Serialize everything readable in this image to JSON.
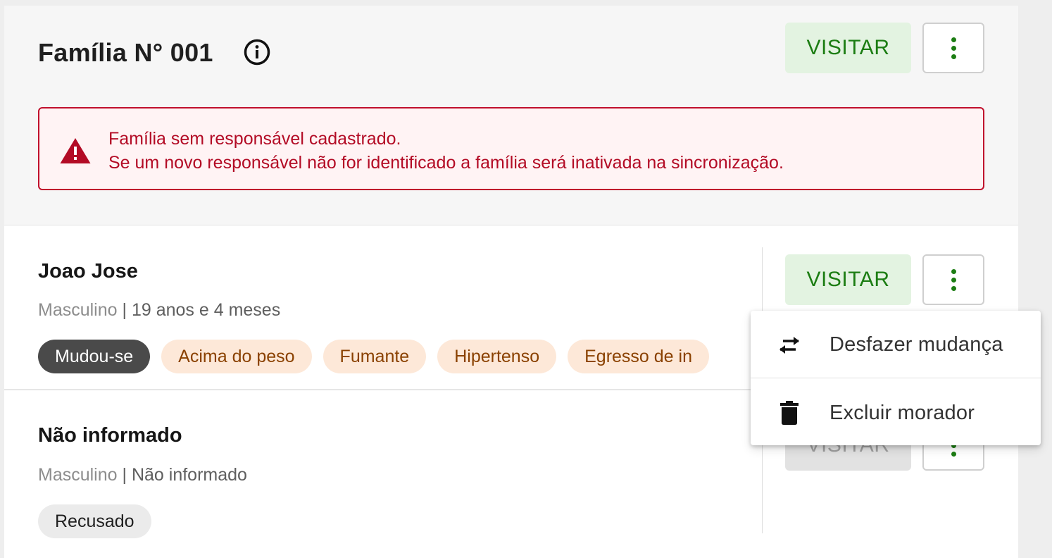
{
  "family": {
    "title": "Família N° 001",
    "info_icon": "info-circle-icon",
    "visit_label": "VISITAR"
  },
  "alert": {
    "icon": "warning-triangle-icon",
    "line1": "Família sem responsável cadastrado.",
    "line2": "Se um novo responsável não for identificado a família será inativada na sincronização."
  },
  "residents": [
    {
      "name": "Joao Jose",
      "gender": "Masculino",
      "separator": " | ",
      "age": "19 anos e 4 meses",
      "visit_label": "VISITAR",
      "chips": [
        "Mudou-se",
        "Acima do peso",
        "Fumante",
        "Hipertenso",
        "Egresso de in"
      ]
    },
    {
      "name": "Não informado",
      "gender": "Masculino",
      "separator": " | ",
      "age": "Não informado",
      "visit_label": "VISITAR",
      "chips": [
        "Recusado"
      ]
    }
  ],
  "menu": {
    "items": [
      {
        "label": "Desfazer mudança",
        "icon": "swap-arrows-icon"
      },
      {
        "label": "Excluir morador",
        "icon": "trash-icon"
      }
    ]
  },
  "colors": {
    "accent_green": "#1c7d13",
    "visit_bg": "#e3f3e1",
    "alert_red": "#b30b25",
    "chip_warn_bg": "#fde8d8",
    "chip_warn_text": "#8a4100",
    "chip_dark_bg": "#4a4a4a"
  }
}
